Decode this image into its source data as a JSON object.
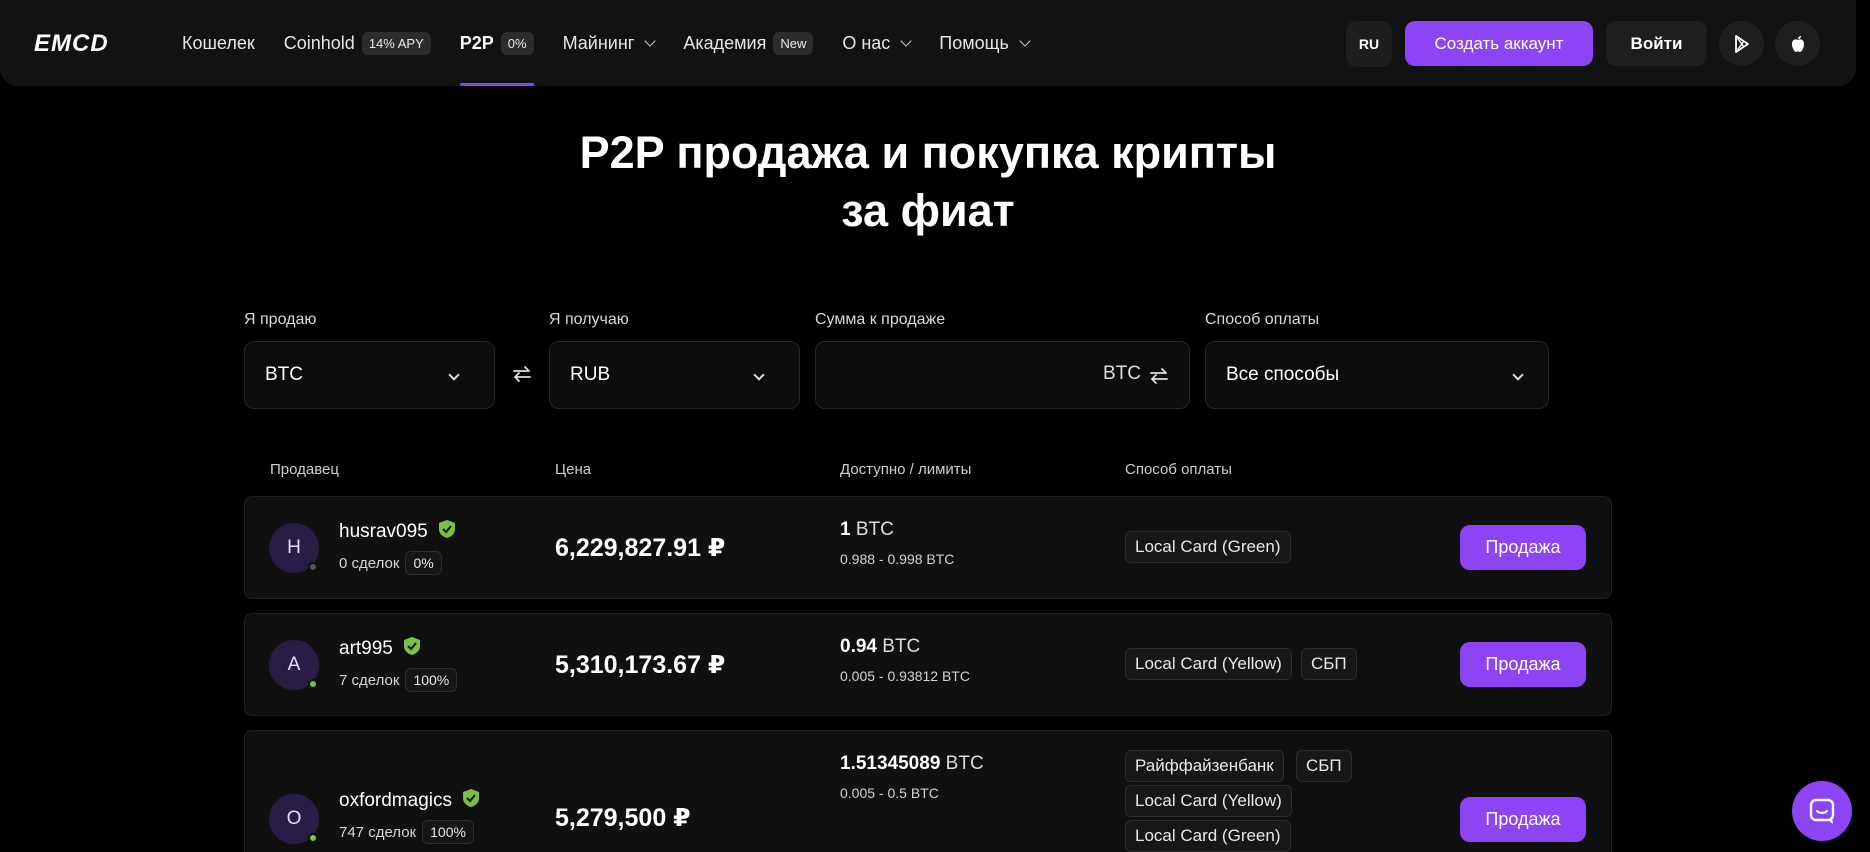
{
  "header": {
    "logo_text": "EMCD",
    "nav": [
      {
        "label": "Кошелек",
        "badge": null,
        "dropdown": false,
        "active": false
      },
      {
        "label": "Coinhold",
        "badge": "14% APY",
        "dropdown": false,
        "active": false
      },
      {
        "label": "P2P",
        "badge": "0%",
        "dropdown": false,
        "active": true
      },
      {
        "label": "Майнинг",
        "badge": null,
        "dropdown": true,
        "active": false
      },
      {
        "label": "Академия",
        "badge": "New",
        "dropdown": false,
        "active": false
      },
      {
        "label": "О нас",
        "badge": null,
        "dropdown": true,
        "active": false
      },
      {
        "label": "Помощь",
        "badge": null,
        "dropdown": true,
        "active": false
      }
    ],
    "lang": "RU",
    "create_account": "Создать аккаунт",
    "login": "Войти",
    "accent": "#8d44f5"
  },
  "hero": {
    "title_line1": "P2P продажа и покупка крипты",
    "title_line2": "за фиат"
  },
  "filters": {
    "sell_label": "Я продаю",
    "sell_value": "BTC",
    "receive_label": "Я получаю",
    "receive_value": "RUB",
    "amount_label": "Сумма к продаже",
    "amount_value": "",
    "amount_unit": "BTC",
    "method_label": "Способ оплаты",
    "method_value": "Все способы"
  },
  "table": {
    "headers": {
      "seller": "Продавец",
      "price": "Цена",
      "available": "Доступно / лимиты",
      "method": "Способ оплаты"
    },
    "rows": [
      {
        "initial": "H",
        "online": false,
        "name": "husrav095",
        "deals": "0 сделок",
        "rate": "0%",
        "price": "6,229,827.91 ₽",
        "available": "1",
        "unit": "BTC",
        "limits": "0.988 - 0.998 BTC",
        "methods": [
          "Local Card (Green)"
        ],
        "action": "Продажа"
      },
      {
        "initial": "A",
        "online": true,
        "name": "art995",
        "deals": "7 сделок",
        "rate": "100%",
        "price": "5,310,173.67 ₽",
        "available": "0.94",
        "unit": "BTC",
        "limits": "0.005 - 0.93812 BTC",
        "methods": [
          "Local Card (Yellow)",
          "СБП"
        ],
        "action": "Продажа"
      },
      {
        "initial": "O",
        "online": true,
        "name": "oxfordmagics",
        "deals": "747 сделок",
        "rate": "100%",
        "price": "5,279,500 ₽",
        "available": "1.51345089",
        "unit": "BTC",
        "limits": "0.005 - 0.5 BTC",
        "methods": [
          "Райффайзенбанк",
          "СБП",
          "Local Card (Yellow)",
          "Local Card (Green)"
        ],
        "action": "Продажа"
      }
    ]
  }
}
